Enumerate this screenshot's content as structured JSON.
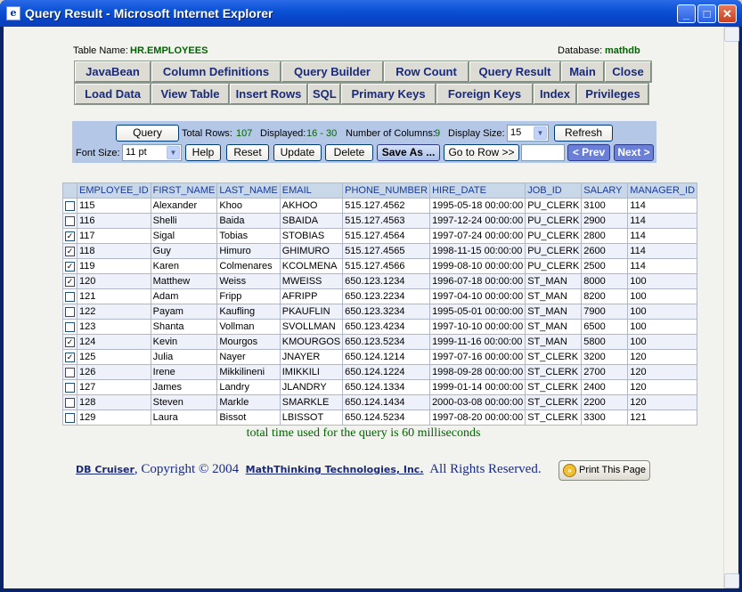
{
  "window": {
    "title": "Query Result - Microsoft Internet Explorer"
  },
  "header": {
    "table_label": "Table Name:",
    "table_name": "HR.EMPLOYEES",
    "db_label": "Database:",
    "db_name": "mathdb"
  },
  "nav_row1": [
    "JavaBean",
    "Column Definitions",
    "Query Builder",
    "Row Count",
    "Query Result",
    "Main",
    "Close"
  ],
  "nav_row2": [
    "Load Data",
    "View Table",
    "Insert Rows",
    "SQL",
    "Primary Keys",
    "Foreign Keys",
    "Index",
    "Privileges"
  ],
  "toolbar": {
    "query_label": "Query",
    "total_rows_label": "Total Rows:",
    "total_rows": "107",
    "displayed_label": "Displayed:",
    "displayed": "16 - 30",
    "columns_label": "Number of Columns:",
    "columns": "9",
    "display_size_label": "Display Size:",
    "display_size": "15",
    "refresh_label": "Refresh",
    "font_size_label": "Font Size:",
    "font_size": "11 pt",
    "help_label": "Help",
    "reset_label": "Reset",
    "update_label": "Update",
    "delete_label": "Delete",
    "save_as_label": "Save As ...",
    "goto_label": "Go to Row >>",
    "goto_value": "",
    "prev_label": "< Prev",
    "next_label": "Next >"
  },
  "table": {
    "columns": [
      "EMPLOYEE_ID",
      "FIRST_NAME",
      "LAST_NAME",
      "EMAIL",
      "PHONE_NUMBER",
      "HIRE_DATE",
      "JOB_ID",
      "SALARY",
      "MANAGER_ID"
    ],
    "rows": [
      {
        "checked": false,
        "cells": [
          "115",
          "Alexander",
          "Khoo",
          "AKHOO",
          "515.127.4562",
          "1995-05-18 00:00:00",
          "PU_CLERK",
          "3100",
          "114"
        ]
      },
      {
        "checked": false,
        "cells": [
          "116",
          "Shelli",
          "Baida",
          "SBAIDA",
          "515.127.4563",
          "1997-12-24 00:00:00",
          "PU_CLERK",
          "2900",
          "114"
        ]
      },
      {
        "checked": true,
        "cells": [
          "117",
          "Sigal",
          "Tobias",
          "STOBIAS",
          "515.127.4564",
          "1997-07-24 00:00:00",
          "PU_CLERK",
          "2800",
          "114"
        ]
      },
      {
        "checked": true,
        "cells": [
          "118",
          "Guy",
          "Himuro",
          "GHIMURO",
          "515.127.4565",
          "1998-11-15 00:00:00",
          "PU_CLERK",
          "2600",
          "114"
        ]
      },
      {
        "checked": true,
        "cells": [
          "119",
          "Karen",
          "Colmenares",
          "KCOLMENA",
          "515.127.4566",
          "1999-08-10 00:00:00",
          "PU_CLERK",
          "2500",
          "114"
        ]
      },
      {
        "checked": true,
        "cells": [
          "120",
          "Matthew",
          "Weiss",
          "MWEISS",
          "650.123.1234",
          "1996-07-18 00:00:00",
          "ST_MAN",
          "8000",
          "100"
        ]
      },
      {
        "checked": false,
        "cells": [
          "121",
          "Adam",
          "Fripp",
          "AFRIPP",
          "650.123.2234",
          "1997-04-10 00:00:00",
          "ST_MAN",
          "8200",
          "100"
        ]
      },
      {
        "checked": false,
        "cells": [
          "122",
          "Payam",
          "Kaufling",
          "PKAUFLIN",
          "650.123.3234",
          "1995-05-01 00:00:00",
          "ST_MAN",
          "7900",
          "100"
        ]
      },
      {
        "checked": false,
        "cells": [
          "123",
          "Shanta",
          "Vollman",
          "SVOLLMAN",
          "650.123.4234",
          "1997-10-10 00:00:00",
          "ST_MAN",
          "6500",
          "100"
        ]
      },
      {
        "checked": true,
        "cells": [
          "124",
          "Kevin",
          "Mourgos",
          "KMOURGOS",
          "650.123.5234",
          "1999-11-16 00:00:00",
          "ST_MAN",
          "5800",
          "100"
        ]
      },
      {
        "checked": true,
        "cells": [
          "125",
          "Julia",
          "Nayer",
          "JNAYER",
          "650.124.1214",
          "1997-07-16 00:00:00",
          "ST_CLERK",
          "3200",
          "120"
        ]
      },
      {
        "checked": false,
        "cells": [
          "126",
          "Irene",
          "Mikkilineni",
          "IMIKKILI",
          "650.124.1224",
          "1998-09-28 00:00:00",
          "ST_CLERK",
          "2700",
          "120"
        ]
      },
      {
        "checked": false,
        "cells": [
          "127",
          "James",
          "Landry",
          "JLANDRY",
          "650.124.1334",
          "1999-01-14 00:00:00",
          "ST_CLERK",
          "2400",
          "120"
        ]
      },
      {
        "checked": false,
        "cells": [
          "128",
          "Steven",
          "Markle",
          "SMARKLE",
          "650.124.1434",
          "2000-03-08 00:00:00",
          "ST_CLERK",
          "2200",
          "120"
        ]
      },
      {
        "checked": false,
        "cells": [
          "129",
          "Laura",
          "Bissot",
          "LBISSOT",
          "650.124.5234",
          "1997-08-20 00:00:00",
          "ST_CLERK",
          "3300",
          "121"
        ]
      }
    ]
  },
  "timing": {
    "prefix": "total time used for the query is",
    "value": "60",
    "suffix": "milliseconds"
  },
  "footer": {
    "product": "DB Cruiser",
    "copyright": ", Copyright © 2004",
    "company": "MathThinking Technologies, Inc.",
    "rights": "All Rights Reserved.",
    "print_label": "Print This Page"
  }
}
